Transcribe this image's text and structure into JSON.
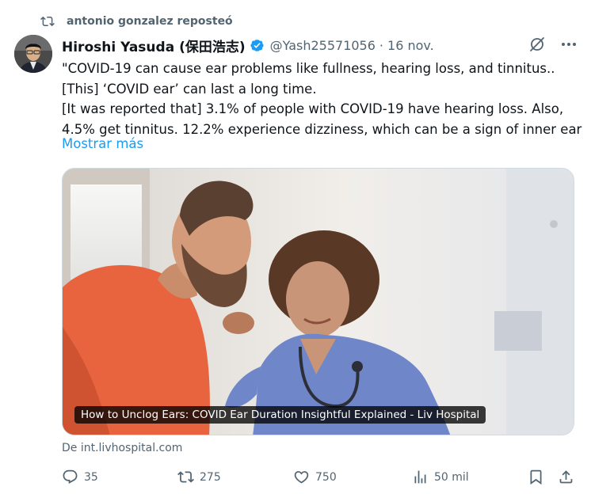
{
  "repost": {
    "text": "antonio gonzalez reposteó",
    "icon": "repost-icon"
  },
  "tweet": {
    "author": "Hiroshi Yasuda (保田浩志)",
    "handle": "@Yash25571056",
    "separator": "·",
    "date": "16 nov.",
    "text_lines": [
      "\"COVID-19 can cause ear problems like fullness, hearing loss, and tinnitus..",
      "[This] ‘COVID ear’ can last a long time.",
      "[It was reported that] 3.1% of people with COVID-19 have hearing loss. Also,",
      "4.5% get tinnitus. 12.2% experience dizziness, which can be a sign of inner ear"
    ],
    "show_more": "Mostrar más"
  },
  "card": {
    "caption": "How to Unclog Ears: COVID Ear Duration Insightful Explained - Liv Hospital",
    "source": "De int.livhospital.com"
  },
  "actions": {
    "replies": "35",
    "reposts": "275",
    "likes": "750",
    "views": "50 mil"
  },
  "colors": {
    "accent": "#1d9bf0",
    "muted": "#536471",
    "text": "#0f1419"
  }
}
